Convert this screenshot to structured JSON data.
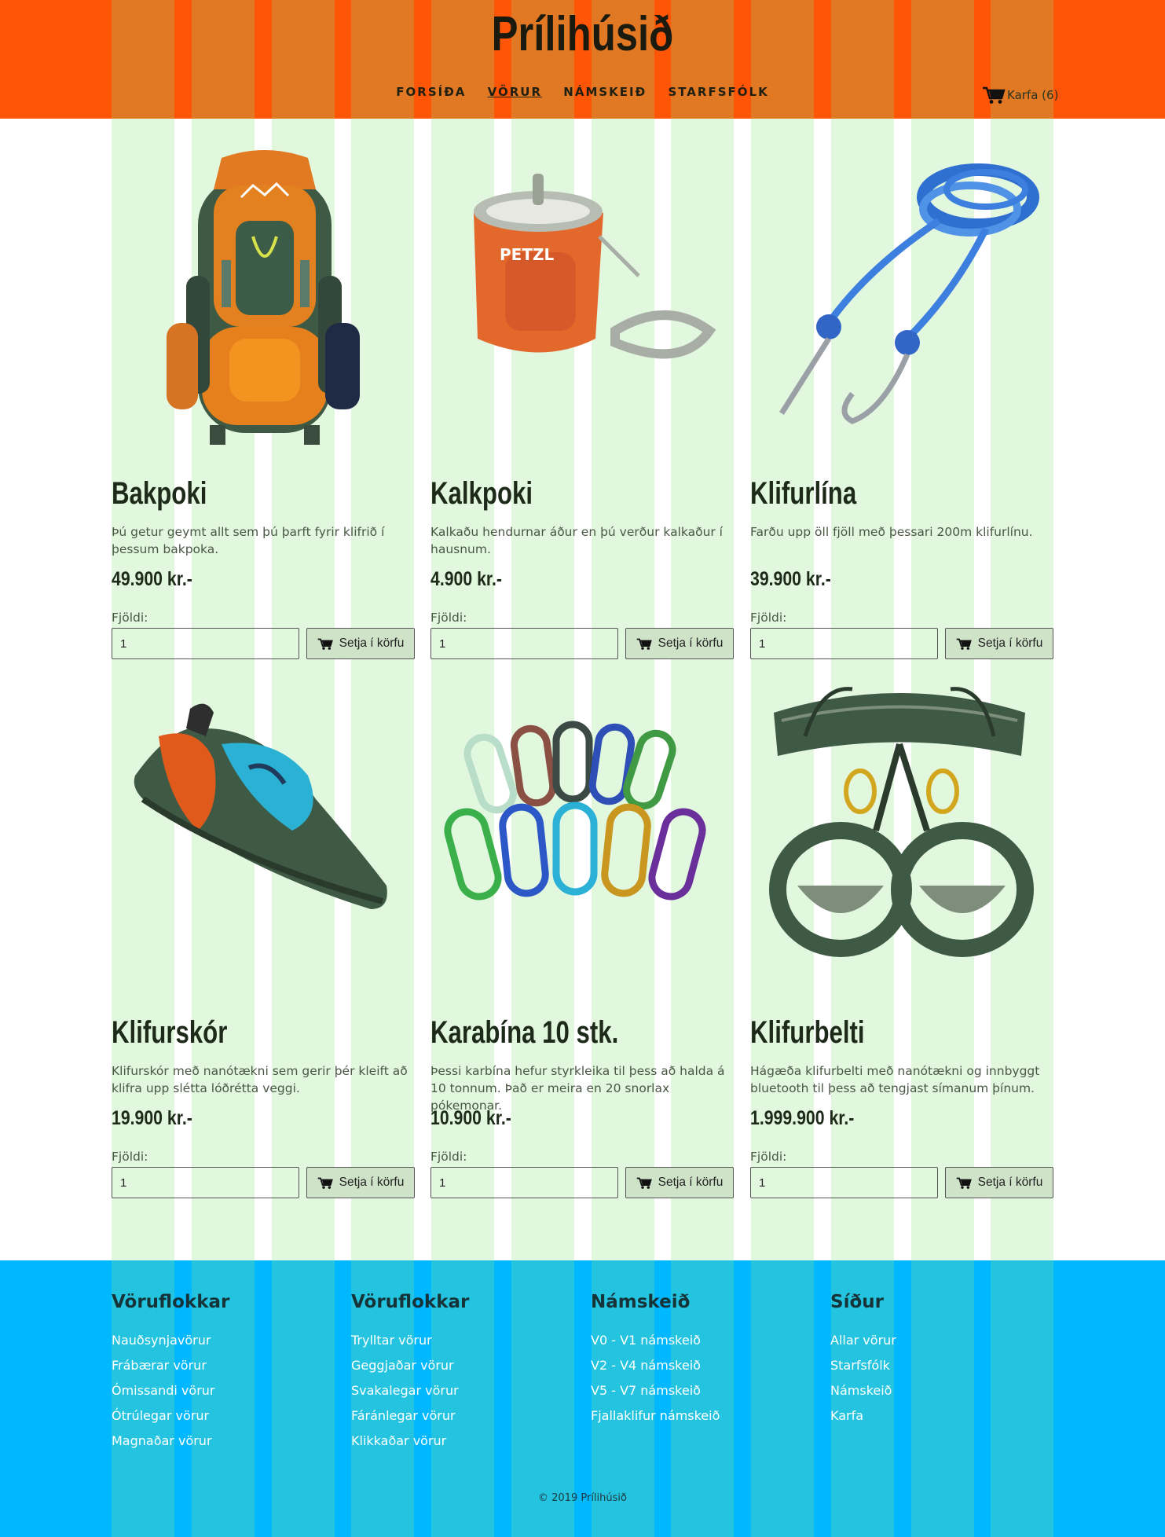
{
  "site": {
    "brand": "Prílihúsið"
  },
  "nav": {
    "items": [
      {
        "label": "FORSÍÐA"
      },
      {
        "label": "VÖRUR"
      },
      {
        "label": "NÁMSKEIÐ"
      },
      {
        "label": "STARFSFÓLK"
      }
    ],
    "active": "VÖRUR",
    "cart_label": "Karfa (6)"
  },
  "products": [
    {
      "title": "Bakpoki",
      "description": "Þú getur geymt allt sem þú þarft fyrir klifrið í þessum bakpoka.",
      "price": "49.900 kr.-",
      "quantity_label": "Fjöldi:",
      "quantity_value": "1",
      "button_label": "Setja í körfu",
      "image": "backpack"
    },
    {
      "title": "Kalkpoki",
      "description": "Kalkaðu hendurnar áður en þú verður kalkaður í hausnum.",
      "price": "4.900 kr.-",
      "quantity_label": "Fjöldi:",
      "quantity_value": "1",
      "button_label": "Setja í körfu",
      "image": "chalk-bag"
    },
    {
      "title": "Klifurlína",
      "description": "Farðu upp öll fjöll með þessari 200m klifurlínu.",
      "price": "39.900 kr.-",
      "quantity_label": "Fjöldi:",
      "quantity_value": "1",
      "button_label": "Setja í körfu",
      "image": "rope"
    },
    {
      "title": "Klifurskór",
      "description": "Klifurskór með nanótækni sem gerir þér kleift að klifra upp slétta lóðrétta veggi.",
      "price": "19.900 kr.-",
      "quantity_label": "Fjöldi:",
      "quantity_value": "1",
      "button_label": "Setja í körfu",
      "image": "climbing-shoe"
    },
    {
      "title": "Karabína 10 stk.",
      "description": "Þessi karbína hefur styrkleika til þess að halda á 10 tonnum. Það er meira en 20 snorlax pókemonar.",
      "price": "10.900 kr.-",
      "quantity_label": "Fjöldi:",
      "quantity_value": "1",
      "button_label": "Setja í körfu",
      "image": "carabiners"
    },
    {
      "title": "Klifurbelti",
      "description": "Hágæða klifurbelti með nanótækni og innbyggt bluetooth til þess að tengjast símanum þínum.",
      "price": "1.999.900 kr.-",
      "quantity_label": "Fjöldi:",
      "quantity_value": "1",
      "button_label": "Setja í körfu",
      "image": "harness"
    }
  ],
  "footer": {
    "columns": [
      {
        "heading": "Vöruflokkar",
        "links": [
          "Nauðsynjavörur",
          "Frábærar vörur",
          "Ómissandi vörur",
          "Ótrúlegar vörur",
          "Magnaðar vörur"
        ]
      },
      {
        "heading": "Vöruflokkar",
        "links": [
          "Trylltar vörur",
          "Geggjaðar vörur",
          "Svakalegar vörur",
          "Fáránlegar vörur",
          "Klikkaðar vörur"
        ]
      },
      {
        "heading": "Námskeið",
        "links": [
          "V0 - V1 námskeið",
          "V2 - V4 námskeið",
          "V5 - V7 námskeið",
          "Fjallaklifur námskeið"
        ]
      },
      {
        "heading": "Síður",
        "links": [
          "Allar vörur",
          "Starfsfólk",
          "Námskeið",
          "Karfa"
        ]
      }
    ],
    "copyright": "© 2019 Prílihúsið"
  },
  "colors": {
    "header_bg": "#ff5507",
    "header_grid": "#e07824",
    "main_grid": "#e1f7de",
    "footer_bg": "#00b8ff",
    "footer_grid": "#24c4e0",
    "button_bg": "#cfe3c9"
  }
}
